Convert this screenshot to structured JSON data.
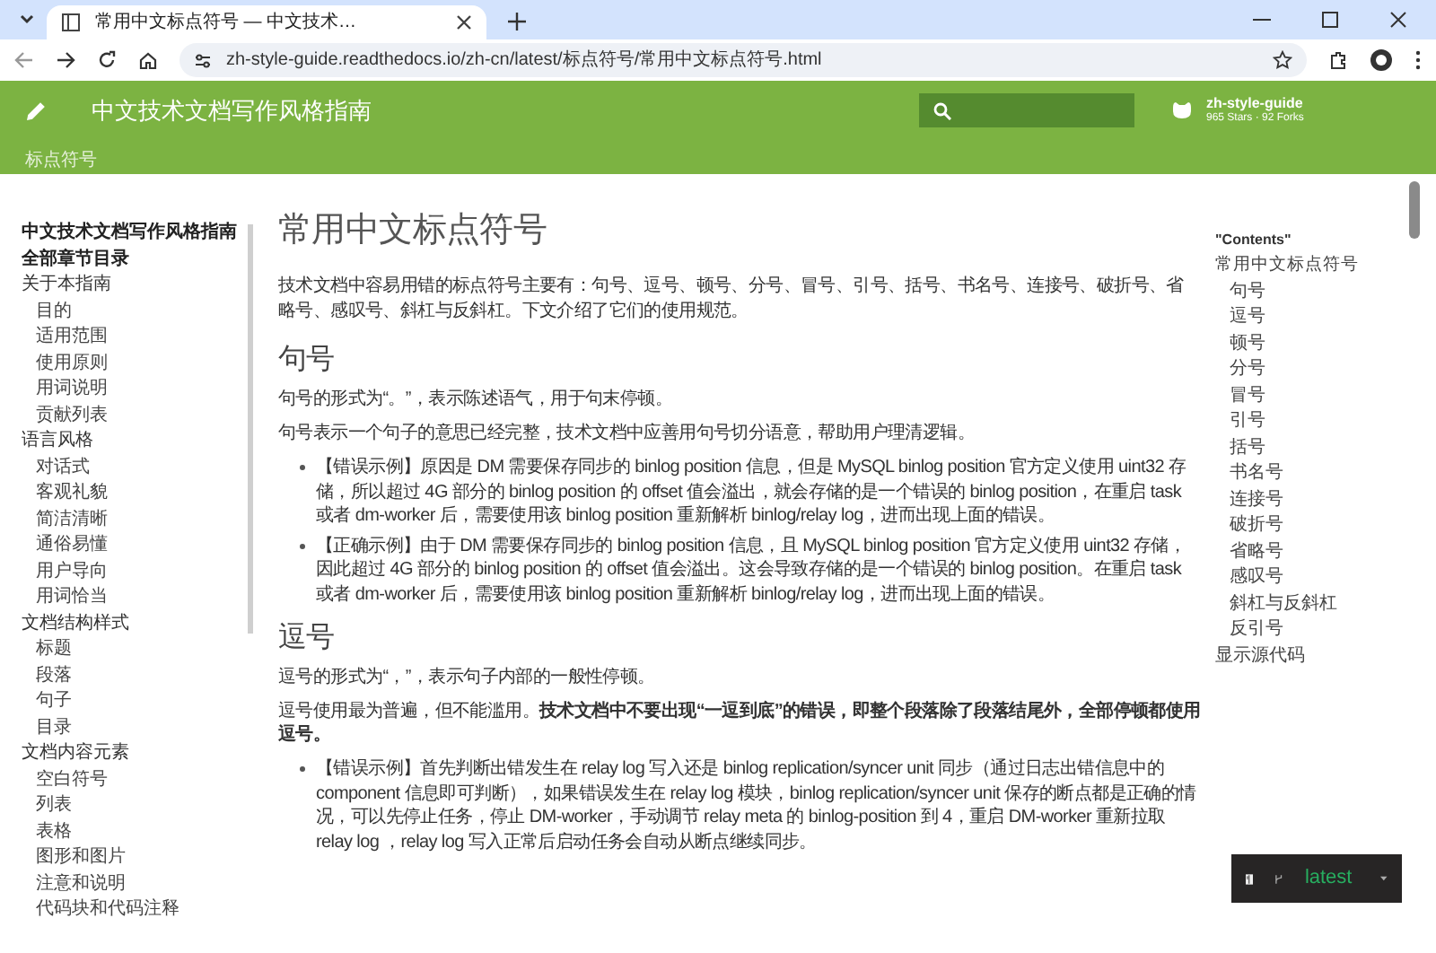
{
  "browser": {
    "tab_title": "常用中文标点符号 — 中文技术…",
    "url": "zh-style-guide.readthedocs.io/zh-cn/latest/标点符号/常用中文标点符号.html"
  },
  "header": {
    "title": "中文技术文档写作风格指南",
    "breadcrumb": "标点符号",
    "repo": {
      "name": "zh-style-guide",
      "stats": "965 Stars · 92 Forks"
    }
  },
  "sidebar": {
    "items": [
      {
        "label": "中文技术文档写作风格指南",
        "kind": "title"
      },
      {
        "label": "全部章节目录",
        "kind": "title"
      },
      {
        "label": "关于本指南",
        "kind": "group",
        "children": [
          {
            "label": "目的"
          },
          {
            "label": "适用范围"
          },
          {
            "label": "使用原则"
          },
          {
            "label": "用词说明"
          },
          {
            "label": "贡献列表"
          }
        ]
      },
      {
        "label": "语言风格",
        "kind": "group",
        "children": [
          {
            "label": "对话式"
          },
          {
            "label": "客观礼貌"
          },
          {
            "label": "简洁清晰"
          },
          {
            "label": "通俗易懂"
          },
          {
            "label": "用户导向"
          },
          {
            "label": "用词恰当"
          }
        ]
      },
      {
        "label": "文档结构样式",
        "kind": "group",
        "children": [
          {
            "label": "标题"
          },
          {
            "label": "段落"
          },
          {
            "label": "句子"
          },
          {
            "label": "目录"
          }
        ]
      },
      {
        "label": "文档内容元素",
        "kind": "group",
        "children": [
          {
            "label": "空白符号"
          },
          {
            "label": "列表"
          },
          {
            "label": "表格"
          },
          {
            "label": "图形和图片"
          },
          {
            "label": "注意和说明"
          },
          {
            "label": "代码块和代码注释"
          }
        ]
      }
    ]
  },
  "article": {
    "title": "常用中文标点符号",
    "intro": "技术文档中容易用错的标点符号主要有：句号、逗号、顿号、分号、冒号、引号、括号、书名号、连接号、破折号、省略号、感叹号、斜杠与反斜杠。下文介绍了它们的使用规范。",
    "sections": [
      {
        "heading": "句号",
        "paragraphs": [
          "句号的形式为“。”，表示陈述语气，用于句末停顿。",
          "句号表示一个句子的意思已经完整，技术文档中应善用句号切分语意，帮助用户理清逻辑。"
        ],
        "bullets": [
          "【错误示例】原因是 DM 需要保存同步的 binlog position 信息，但是 MySQL binlog position 官方定义使用 uint32 存储，所以超过 4G 部分的 binlog position 的 offset 值会溢出，就会存储的是一个错误的 binlog position，在重启 task 或者 dm-worker 后，需要使用该 binlog position 重新解析 binlog/relay log，进而出现上面的错误。",
          "【正确示例】由于 DM 需要保存同步的 binlog position 信息，且 MySQL binlog position 官方定义使用 uint32 存储，因此超过 4G 部分的 binlog position 的 offset 值会溢出。这会导致存储的是一个错误的 binlog position。在重启 task 或者 dm-worker 后，需要使用该 binlog position 重新解析 binlog/relay log，进而出现上面的错误。"
        ]
      },
      {
        "heading": "逗号",
        "paragraphs": [
          "逗号的形式为“，”，表示句子内部的一般性停顿。",
          "逗号使用最为普遍，但不能滥用。**技术文档中不要出现“一逗到底”的错误，即整个段落除了段落结尾外，全部停顿都使用逗号。**"
        ],
        "bullets": [
          "【错误示例】首先判断出错发生在 relay log 写入还是 binlog replication/syncer unit 同步（通过日志出错信息中的 component 信息即可判断），如果错误发生在 relay log 模块，binlog replication/syncer unit 保存的断点都是正确的情况，可以先停止任务，停止 DM-worker，手动调节 relay meta 的 binlog-position 到 4，重启 DM-worker 重新拉取 relay log ，relay log 写入正常后启动任务会自动从断点继续同步。"
        ]
      }
    ]
  },
  "toc": {
    "heading": "\"Contents\"",
    "items": [
      {
        "label": "常用中文标点符号",
        "children": [
          {
            "label": "句号"
          },
          {
            "label": "逗号"
          },
          {
            "label": "顿号"
          },
          {
            "label": "分号"
          },
          {
            "label": "冒号"
          },
          {
            "label": "引号"
          },
          {
            "label": "括号"
          },
          {
            "label": "书名号"
          },
          {
            "label": "连接号"
          },
          {
            "label": "破折号"
          },
          {
            "label": "省略号"
          },
          {
            "label": "感叹号"
          },
          {
            "label": "斜杠与反斜杠"
          },
          {
            "label": "反引号"
          }
        ]
      }
    ],
    "source_link": "显示源代码"
  },
  "version_badge": {
    "version": "latest"
  }
}
